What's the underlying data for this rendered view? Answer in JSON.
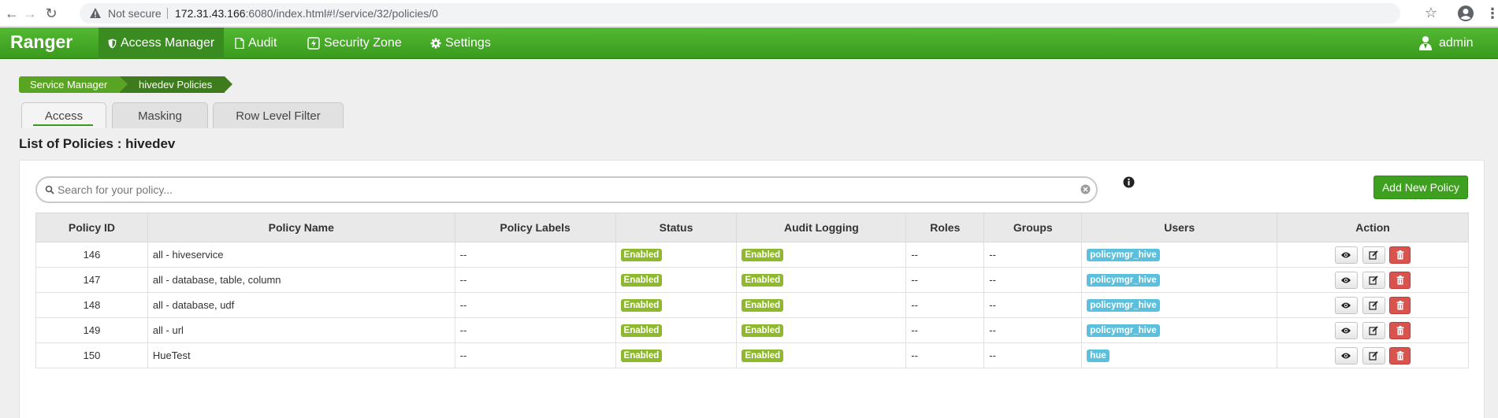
{
  "browser": {
    "security_text": "Not secure",
    "url_host": "172.31.43.166",
    "url_rest": ":6080/index.html#!/service/32/policies/0"
  },
  "topnav": {
    "brand": "Ranger",
    "items": [
      {
        "label": "Access Manager",
        "icon": "shield-icon",
        "active": true
      },
      {
        "label": "Audit",
        "icon": "file-icon"
      },
      {
        "label": "Security Zone",
        "icon": "bolt-icon"
      },
      {
        "label": "Settings",
        "icon": "gear-icon"
      }
    ],
    "user": "admin"
  },
  "breadcrumb": [
    "Service Manager",
    "hivedev Policies"
  ],
  "tabs": [
    {
      "label": "Access",
      "active": true
    },
    {
      "label": "Masking"
    },
    {
      "label": "Row Level Filter"
    }
  ],
  "page_title": "List of Policies : hivedev",
  "search": {
    "placeholder": "Search for your policy..."
  },
  "add_button": "Add New Policy",
  "table": {
    "headers": [
      "Policy ID",
      "Policy Name",
      "Policy Labels",
      "Status",
      "Audit Logging",
      "Roles",
      "Groups",
      "Users",
      "Action"
    ],
    "rows": [
      {
        "id": "146",
        "name": "all - hiveservice",
        "labels": "--",
        "status": "Enabled",
        "audit": "Enabled",
        "roles": "--",
        "groups": "--",
        "users": "policymgr_hive"
      },
      {
        "id": "147",
        "name": "all - database, table, column",
        "labels": "--",
        "status": "Enabled",
        "audit": "Enabled",
        "roles": "--",
        "groups": "--",
        "users": "policymgr_hive"
      },
      {
        "id": "148",
        "name": "all - database, udf",
        "labels": "--",
        "status": "Enabled",
        "audit": "Enabled",
        "roles": "--",
        "groups": "--",
        "users": "policymgr_hive"
      },
      {
        "id": "149",
        "name": "all - url",
        "labels": "--",
        "status": "Enabled",
        "audit": "Enabled",
        "roles": "--",
        "groups": "--",
        "users": "policymgr_hive"
      },
      {
        "id": "150",
        "name": "HueTest",
        "labels": "--",
        "status": "Enabled",
        "audit": "Enabled",
        "roles": "--",
        "groups": "--",
        "users": "hue"
      }
    ]
  },
  "colors": {
    "nav_green": "#4aab28",
    "enabled_label": "#8db92b",
    "user_label": "#5bc0de",
    "delete_button": "#d9534f"
  }
}
